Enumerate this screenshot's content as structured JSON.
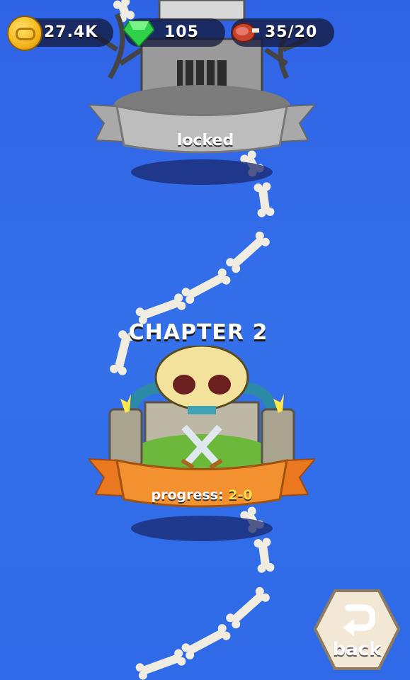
{
  "currency": {
    "coins": "27.4K",
    "gems": "105",
    "energy": "35/20"
  },
  "chapter_locked": {
    "status": "locked"
  },
  "chapter2": {
    "title": "CHAPTER 2",
    "progress_label": "progress:",
    "progress_value": "2-0"
  },
  "nav": {
    "back_label": "back"
  },
  "colors": {
    "background": "#3068e8",
    "ribbon_locked": "#b9b9b9",
    "ribbon_active": "#f08a2c",
    "progress_value": "#ffe04a"
  },
  "icons": [
    "coin-icon",
    "gem-icon",
    "meat-icon",
    "crossed-swords-icon",
    "back-arrow-icon"
  ]
}
